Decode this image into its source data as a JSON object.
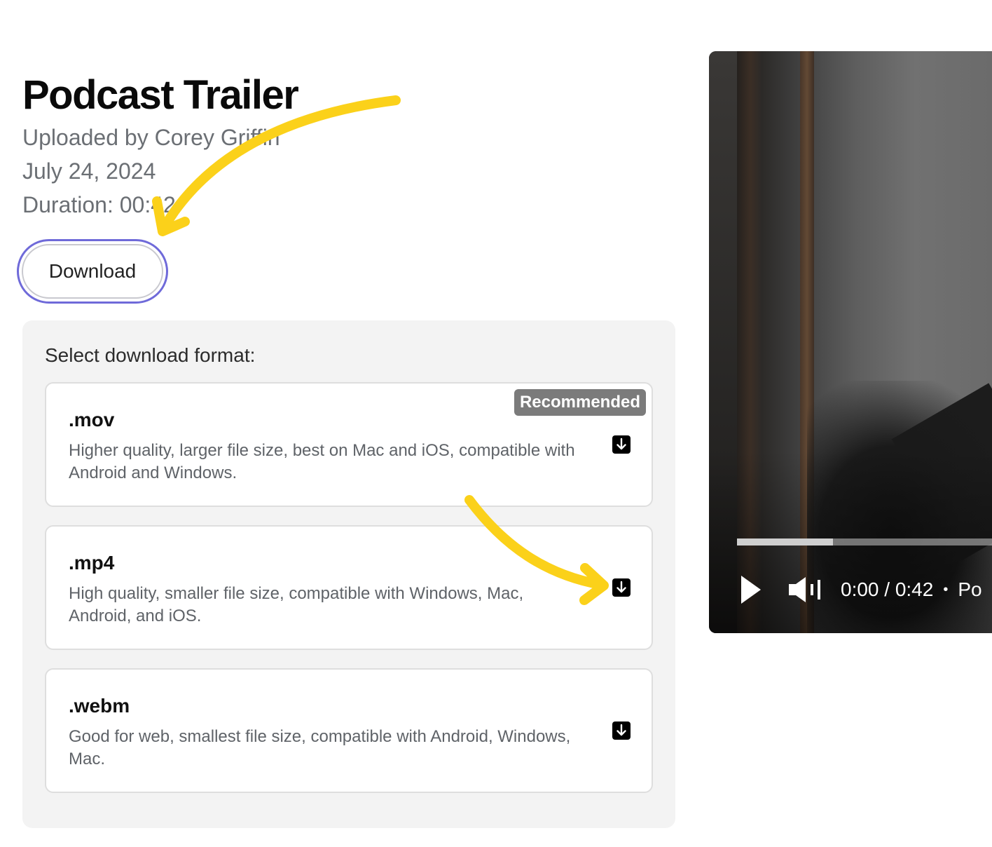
{
  "media": {
    "title": "Podcast Trailer",
    "uploaded_by": "Uploaded by Corey Griffin",
    "date": "July 24, 2024",
    "duration": "Duration: 00:42"
  },
  "download_button": {
    "label": "Download"
  },
  "format_panel": {
    "heading": "Select download format:",
    "formats": [
      {
        "name": ".mov",
        "description": "Higher quality, larger file size, best on Mac and iOS, compatible with Android and Windows.",
        "badge": "Recommended",
        "icon": "download-arrow-icon"
      },
      {
        "name": ".mp4",
        "description": "High quality, smaller file size, compatible with Windows, Mac, Android, and iOS.",
        "icon": "download-arrow-icon"
      },
      {
        "name": ".webm",
        "description": "Good for web, smallest file size, compatible with Android, Windows, Mac.",
        "icon": "download-arrow-icon"
      }
    ]
  },
  "player": {
    "time": "0:00 / 0:42",
    "title_visible": "Po",
    "progress_buffered_fraction": 0.36,
    "play_icon": "play-icon",
    "volume_icon": "volume-icon"
  },
  "colors": {
    "accent_outline": "#6f6ad9",
    "annotation_arrow": "#fbd11a",
    "badge_bg": "#7b7b7b"
  }
}
